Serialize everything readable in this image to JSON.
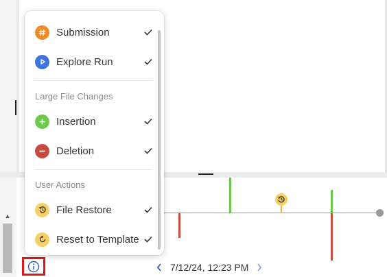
{
  "menu": {
    "items_top": [
      {
        "label": "Submission",
        "icon": "hash-icon",
        "color": "#f08a24",
        "checked": true
      },
      {
        "label": "Explore Run",
        "icon": "play-icon",
        "color": "#3f74e0",
        "checked": true
      }
    ],
    "section_large": "Large File Changes",
    "items_large": [
      {
        "label": "Insertion",
        "icon": "plus-icon",
        "color": "#6cc94c",
        "checked": true
      },
      {
        "label": "Deletion",
        "icon": "minus-icon",
        "color": "#c94a3f",
        "checked": true
      }
    ],
    "section_user": "User Actions",
    "items_user": [
      {
        "label": "File Restore",
        "icon": "history-icon",
        "color": "#f8cf63",
        "checked": true
      },
      {
        "label": "Reset to Template",
        "icon": "reset-icon",
        "color": "#f8cf63",
        "checked": true
      }
    ]
  },
  "timeline": {
    "date": "7/12/24, 12:23 PM",
    "colors": {
      "insertion": "#6cc94c",
      "deletion": "#c94a3f",
      "restore": "#f8cf63",
      "axis": "#9a9a9a"
    }
  },
  "info_button": {
    "icon": "info-icon",
    "highlight": "#e0141b"
  }
}
